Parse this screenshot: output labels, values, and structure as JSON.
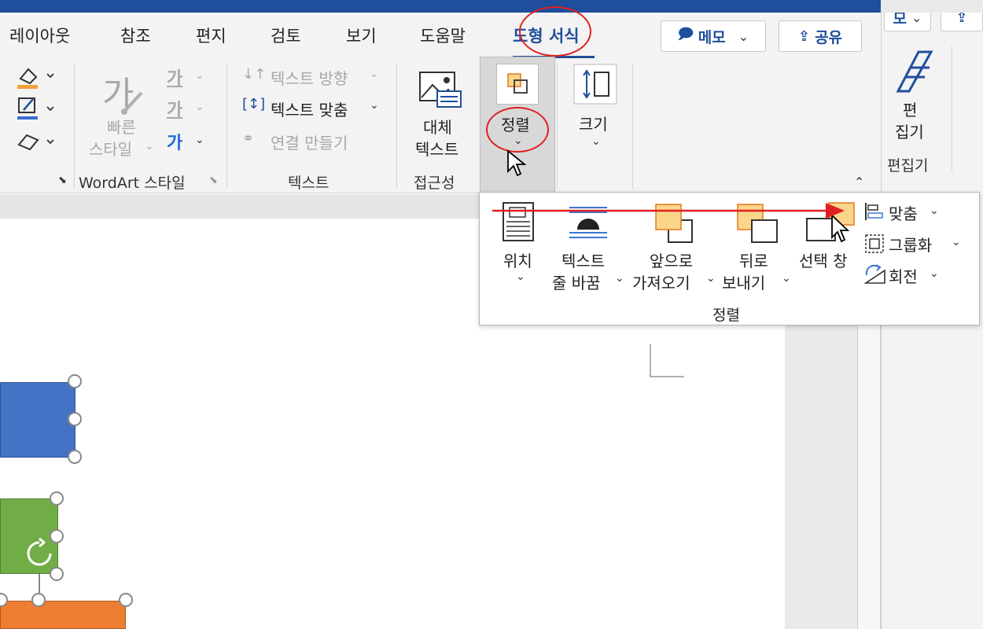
{
  "tabs": [
    {
      "label": "레이아웃"
    },
    {
      "label": "참조"
    },
    {
      "label": "편지"
    },
    {
      "label": "검토"
    },
    {
      "label": "보기"
    },
    {
      "label": "도움말"
    },
    {
      "label": "도형 서식"
    }
  ],
  "header_buttons": {
    "memo": "메모",
    "share": "공유",
    "right_partial": "모"
  },
  "ribbon": {
    "quick_style": {
      "glyph": "가",
      "label_line1": "빠른",
      "label_line2": "스타일"
    },
    "text_variants": [
      "가",
      "가",
      "가"
    ],
    "text_direction": "텍스트 방향",
    "align_text": "텍스트 맞춤",
    "create_link": "연결 만들기",
    "alt_text": {
      "line1": "대체",
      "line2": "텍스트"
    },
    "arrange": "정렬",
    "size": "크기",
    "editor": {
      "line1": "편",
      "line2": "집기"
    },
    "groups": {
      "wordart": "WordArt 스타일",
      "text": "텍스트",
      "accessibility": "접근성",
      "editor": "편집기"
    }
  },
  "dropdown": {
    "items": [
      {
        "line1": "위치",
        "line2": ""
      },
      {
        "line1": "텍스트",
        "line2": "줄 바꿈"
      },
      {
        "line1": "앞으로",
        "line2": "가져오기"
      },
      {
        "line1": "뒤로",
        "line2": "보내기"
      },
      {
        "line1": "선택 창",
        "line2": ""
      }
    ],
    "side_items": [
      "맞춤",
      "그룹화",
      "회전"
    ],
    "group_label": "정렬"
  },
  "colors": {
    "accent": "#1f4e9c",
    "annotation_red": "#e02020",
    "shape_blue": "#4472c4",
    "shape_green": "#70ad47",
    "shape_orange": "#ed7d31",
    "arrange_fill": "#fbd58a"
  }
}
